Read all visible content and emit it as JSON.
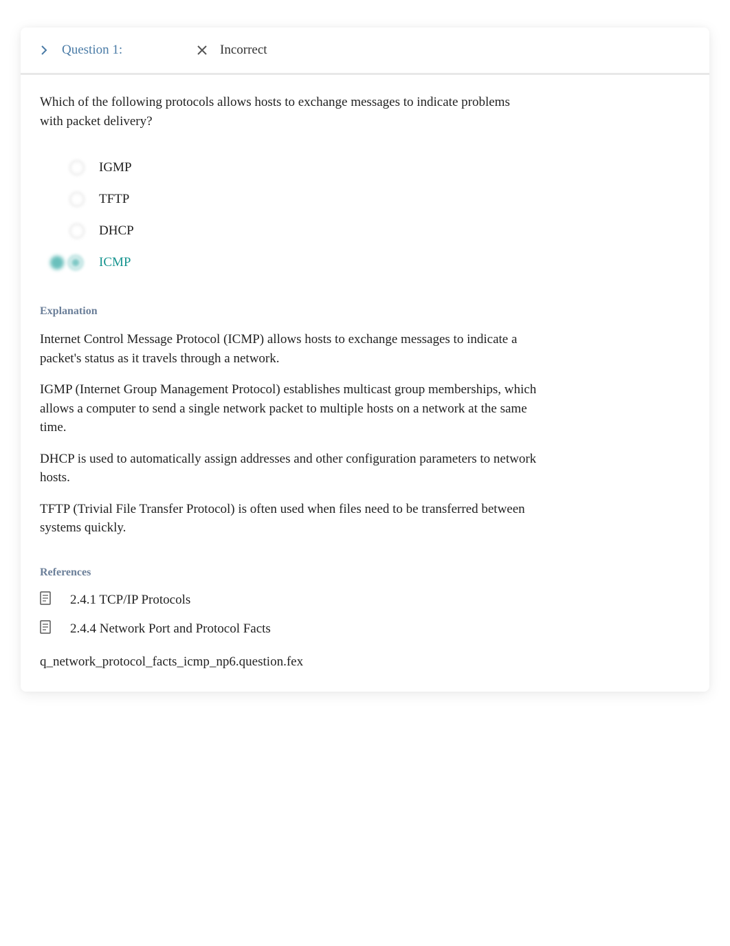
{
  "header": {
    "question_label": "Question 1:",
    "status_label": "Incorrect"
  },
  "question": {
    "text": "Which of the following protocols allows hosts to exchange messages to indicate problems with packet delivery?"
  },
  "options": [
    {
      "label": "IGMP",
      "correct": false
    },
    {
      "label": "TFTP",
      "correct": false
    },
    {
      "label": "DHCP",
      "correct": false
    },
    {
      "label": "ICMP",
      "correct": true
    }
  ],
  "explanation": {
    "heading": "Explanation",
    "paragraphs": [
      "Internet Control Message Protocol (ICMP) allows hosts to exchange messages to indicate a packet's status as it travels through a network.",
      "IGMP (Internet Group Management Protocol) establishes multicast group memberships, which allows a computer to send a single network packet to multiple hosts on a network at the same time.",
      "DHCP is used to automatically assign addresses and other configuration parameters to network hosts.",
      "TFTP (Trivial File Transfer Protocol) is often used when files need to be transferred between systems quickly."
    ]
  },
  "references": {
    "heading": "References",
    "items": [
      "2.4.1 TCP/IP Protocols",
      "2.4.4 Network Port and Protocol Facts"
    ]
  },
  "question_file": "q_network_protocol_facts_icmp_np6.question.fex"
}
